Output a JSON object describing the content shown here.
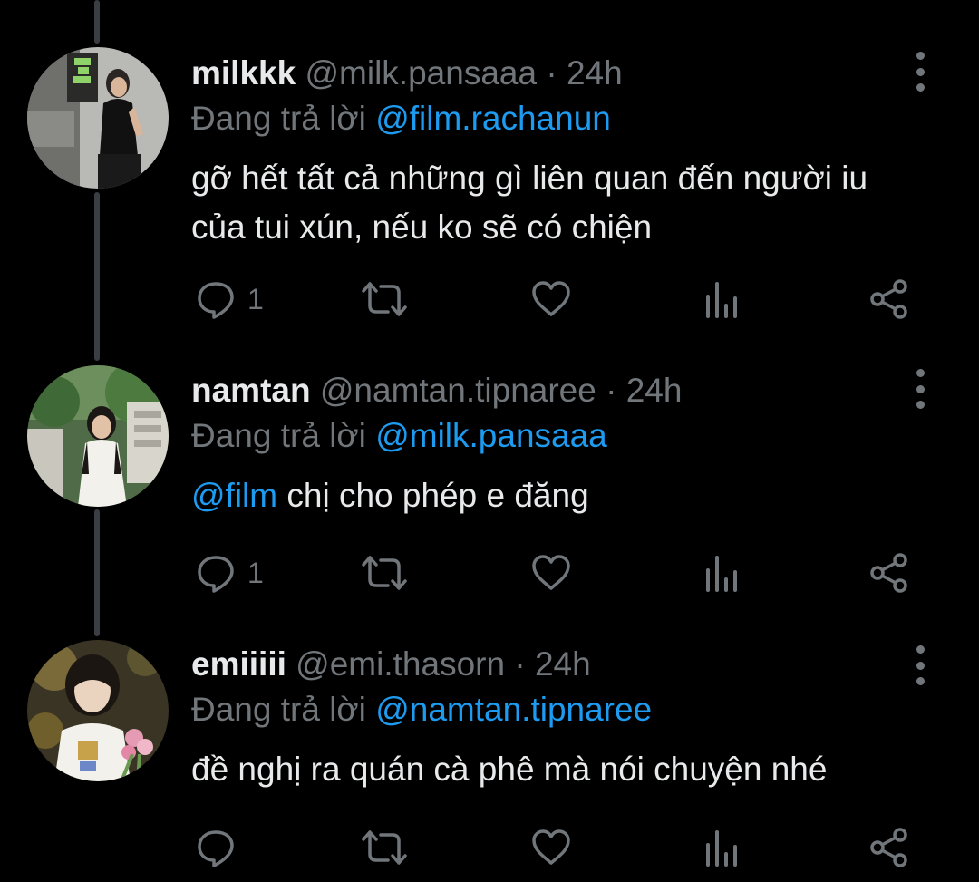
{
  "colors": {
    "background": "#000000",
    "text": "#e7e9ea",
    "secondary": "#71767b",
    "accent": "#1d9bf0",
    "thread_line": "#3a3d41"
  },
  "reply_prefix": "Đang trả lời",
  "icons": {
    "reply": "speech-bubble-icon",
    "retweet": "retweet-icon",
    "like": "heart-icon",
    "views": "bar-chart-icon",
    "share": "share-icon",
    "more": "vertical-dots-icon"
  },
  "tweets": [
    {
      "display_name": "milkkk",
      "handle": "@milk.pansaaa",
      "dot": "·",
      "time": "24h",
      "reply_to": "@film.rachanun",
      "text": "gỡ hết tất cả những gì liên quan đến người iu của tui xún, nếu ko sẽ có chiện",
      "reply_count": "1"
    },
    {
      "display_name": "namtan",
      "handle": "@namtan.tipnaree",
      "dot": "·",
      "time": "24h",
      "reply_to": "@milk.pansaaa",
      "mention": "@film",
      "text": " chị cho phép e đăng",
      "reply_count": "1"
    },
    {
      "display_name": "emiiiii",
      "handle": "@emi.thasorn",
      "dot": "·",
      "time": "24h",
      "reply_to": "@namtan.tipnaree",
      "text": "đề nghị ra quán cà phê mà nói chuyện nhé",
      "reply_count": ""
    }
  ]
}
